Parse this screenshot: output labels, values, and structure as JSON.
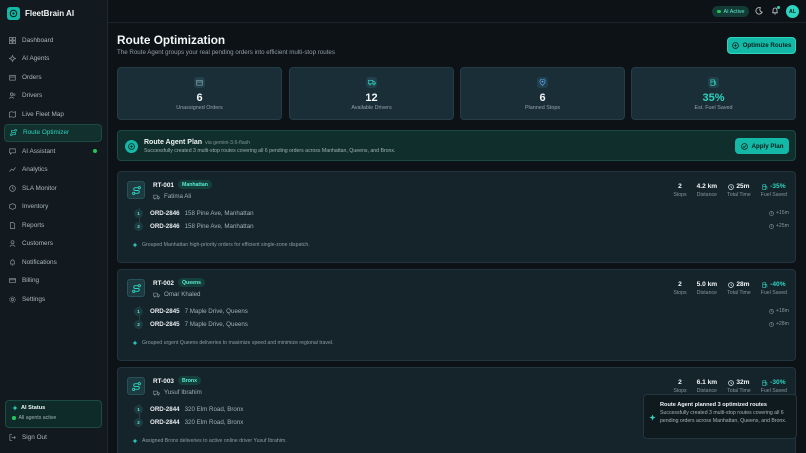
{
  "brand": {
    "name": "FleetBrain AI"
  },
  "sidebar": {
    "items": [
      {
        "label": "Dashboard",
        "icon": "grid-icon"
      },
      {
        "label": "AI Agents",
        "icon": "sparkle-icon"
      },
      {
        "label": "Orders",
        "icon": "box-icon"
      },
      {
        "label": "Drivers",
        "icon": "users-icon"
      },
      {
        "label": "Live Fleet Map",
        "icon": "map-icon"
      },
      {
        "label": "Route Optimizer",
        "icon": "route-icon",
        "active": true
      },
      {
        "label": "AI Assistant",
        "icon": "chat-icon",
        "dot": true
      },
      {
        "label": "Analytics",
        "icon": "chart-icon"
      },
      {
        "label": "SLA Monitor",
        "icon": "clock-icon"
      },
      {
        "label": "Inventory",
        "icon": "package-icon"
      },
      {
        "label": "Reports",
        "icon": "file-icon"
      },
      {
        "label": "Customers",
        "icon": "user-icon"
      },
      {
        "label": "Notifications",
        "icon": "bell-icon"
      },
      {
        "label": "Billing",
        "icon": "card-icon"
      },
      {
        "label": "Settings",
        "icon": "gear-icon"
      }
    ],
    "ai_status": {
      "title": "AI Status",
      "subtitle": "All agents active"
    },
    "signout": "Sign Out"
  },
  "topbar": {
    "ai_active": "AI Active",
    "avatar": "AL"
  },
  "page": {
    "title": "Route Optimization",
    "subtitle": "The Route Agent groups your real pending orders into efficient multi-stop routes",
    "optimize_button": "Optimize Routes"
  },
  "stats": [
    {
      "value": "6",
      "label": "Unassigned Orders",
      "icon": "box-icon"
    },
    {
      "value": "12",
      "label": "Available Drivers",
      "icon": "truck-icon"
    },
    {
      "value": "6",
      "label": "Planned Stops",
      "icon": "pin-icon"
    },
    {
      "value": "35%",
      "label": "Est. Fuel Saved",
      "icon": "fuel-icon"
    }
  ],
  "plan": {
    "title": "Route Agent Plan",
    "via": "via gemini-3.6-flash",
    "description": "Successfully created 3 multi-stop routes covering all 6 pending orders across Manhattan, Queens, and Bronx.",
    "apply_button": "Apply Plan"
  },
  "metric_labels": {
    "stops": "Stops",
    "distance": "Distance",
    "total_time": "Total Time",
    "fuel_saved": "Fuel Saved"
  },
  "routes": [
    {
      "id": "RT-001",
      "zone": "Manhattan",
      "driver": "Fatima Ali",
      "stops": "2",
      "distance": "4.2 km",
      "time": "25m",
      "fuel": "-35%",
      "orders": [
        {
          "num": "1",
          "order": "ORD-2846",
          "address": "158 Pine Ave, Manhattan",
          "eta": "+15m"
        },
        {
          "num": "2",
          "order": "ORD-2846",
          "address": "158 Pine Ave, Manhattan",
          "eta": "+25m"
        }
      ],
      "note": "Grouped Manhattan high-priority orders for efficient single-zone dispatch."
    },
    {
      "id": "RT-002",
      "zone": "Queens",
      "driver": "Omar Khaled",
      "stops": "2",
      "distance": "5.0 km",
      "time": "28m",
      "fuel": "-40%",
      "orders": [
        {
          "num": "1",
          "order": "ORD-2845",
          "address": "7 Maple Drive, Queens",
          "eta": "+18m"
        },
        {
          "num": "2",
          "order": "ORD-2845",
          "address": "7 Maple Drive, Queens",
          "eta": "+28m"
        }
      ],
      "note": "Grouped urgent Queens deliveries to maximize speed and minimize regional travel."
    },
    {
      "id": "RT-003",
      "zone": "Bronx",
      "driver": "Yusuf Ibrahim",
      "stops": "2",
      "distance": "6.1 km",
      "time": "32m",
      "fuel": "-30%",
      "orders": [
        {
          "num": "1",
          "order": "ORD-2844",
          "address": "320 Elm Road, Bronx",
          "eta": ""
        },
        {
          "num": "2",
          "order": "ORD-2844",
          "address": "320 Elm Road, Bronx",
          "eta": ""
        }
      ],
      "note": "Assigned Bronx deliveries to active online driver Yusuf Ibrahim."
    }
  ],
  "toast": {
    "title": "Route Agent planned 3 optimized routes",
    "description": "Successfully created 3 multi-stop routes covering all 6 pending orders across Manhattan, Queens, and Bronx."
  },
  "colors": {
    "accent": "#14b8a6",
    "accent_light": "#2dd4bf",
    "background": "#0d1216",
    "sidebar": "#121a1f",
    "card": "#15232b",
    "stat_card": "#1a2e38"
  }
}
